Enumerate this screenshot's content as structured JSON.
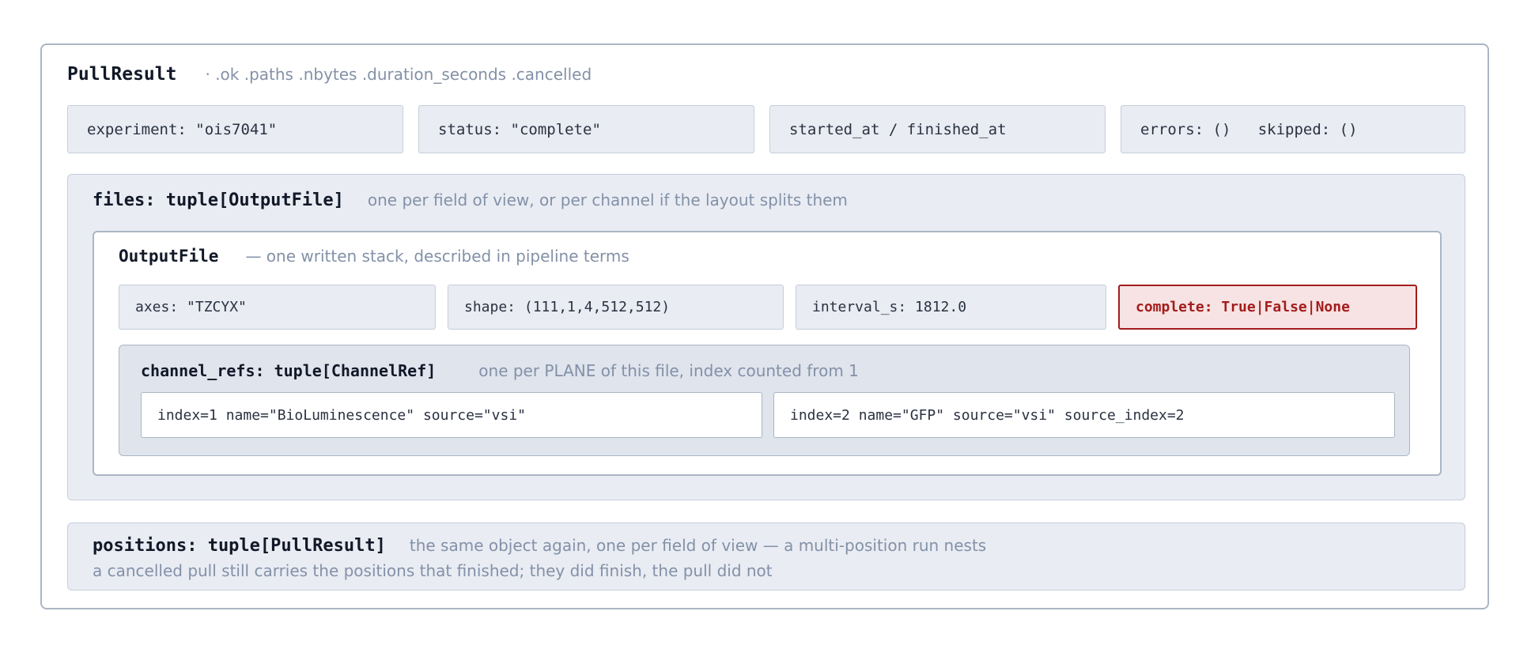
{
  "pull_result": {
    "title": "PullResult",
    "subtitle": "· .ok .paths .nbytes .duration_seconds .cancelled",
    "fields": [
      "experiment: \"ois7041\"",
      "status: \"complete\"",
      "started_at / finished_at",
      "errors: ()   skipped: ()"
    ]
  },
  "files": {
    "title": "files: tuple[OutputFile]",
    "note": "one per field of view, or per channel if the layout splits them",
    "output_file": {
      "title": "OutputFile",
      "note": "— one written stack, described in pipeline terms",
      "fields": [
        "axes: \"TZCYX\"",
        "shape: (111,1,4,512,512)",
        "interval_s: 1812.0"
      ],
      "complete": "complete: True|False|None",
      "complete_color": "#a31c1c"
    },
    "channel_refs": {
      "title": "channel_refs: tuple[ChannelRef]",
      "note": "one per PLANE of this file, index counted from 1",
      "items": [
        "index=1 name=\"BioLuminescence\" source=\"vsi\"",
        "index=2 name=\"GFP\" source=\"vsi\" source_index=2"
      ]
    }
  },
  "positions": {
    "title": "positions: tuple[PullResult]",
    "note": "the same object again, one per field of view — a multi-position run nests",
    "note2": "a cancelled pull still carries the positions that finished; they did finish, the pull did not"
  }
}
